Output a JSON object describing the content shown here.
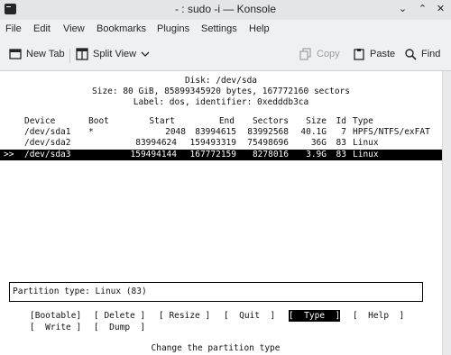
{
  "window": {
    "title": "- : sudo -i — Konsole",
    "controls": {
      "minimize": "⌄",
      "maximize": "⌃",
      "close": "✕"
    }
  },
  "menubar": [
    "File",
    "Edit",
    "View",
    "Bookmarks",
    "Plugins",
    "Settings",
    "Help"
  ],
  "toolbar": {
    "new_tab": "New Tab",
    "split_view": "Split View",
    "copy": "Copy",
    "paste": "Paste",
    "find": "Find"
  },
  "terminal": {
    "disk_line": "Disk: /dev/sda",
    "size_line": "Size: 80 GiB, 85899345920 bytes, 167772160 sectors",
    "label_line": "Label: dos, identifier: 0xedddb3ca",
    "columns": [
      "Device",
      "Boot",
      "Start",
      "End",
      "Sectors",
      "Size",
      "Id",
      "Type"
    ],
    "rows": [
      {
        "marker": "",
        "device": "/dev/sda1",
        "boot": "*",
        "start": "2048",
        "end": "83994615",
        "sectors": "83992568",
        "size": "40.1G",
        "id": "7",
        "type": "HPFS/NTFS/exFAT"
      },
      {
        "marker": "",
        "device": "/dev/sda2",
        "boot": "",
        "start": "83994624",
        "end": "159493319",
        "sectors": "75498696",
        "size": "36G",
        "id": "83",
        "type": "Linux"
      },
      {
        "marker": ">>",
        "device": "/dev/sda3",
        "boot": "",
        "start": "159494144",
        "end": "167772159",
        "sectors": "8278016",
        "size": "3.9G",
        "id": "83",
        "type": "Linux"
      }
    ],
    "partition_type": "Partition type: Linux (83)",
    "menu": [
      {
        "label": "[Bootable]",
        "selected": false
      },
      {
        "label": "[ Delete ]",
        "selected": false
      },
      {
        "label": "[ Resize ]",
        "selected": false
      },
      {
        "label": "[  Quit  ]",
        "selected": false
      },
      {
        "label": "[  Type  ]",
        "selected": true
      },
      {
        "label": "[  Help  ]",
        "selected": false
      },
      {
        "label": "[  Write ]",
        "selected": false
      },
      {
        "label": "[  Dump  ]",
        "selected": false
      }
    ],
    "hint": "Change the partition type"
  },
  "colors": {
    "selection_bg": "#000000",
    "selection_fg": "#ffffff",
    "terminal_bg": "#ffffff",
    "chrome_bg": "#eff0f1"
  }
}
